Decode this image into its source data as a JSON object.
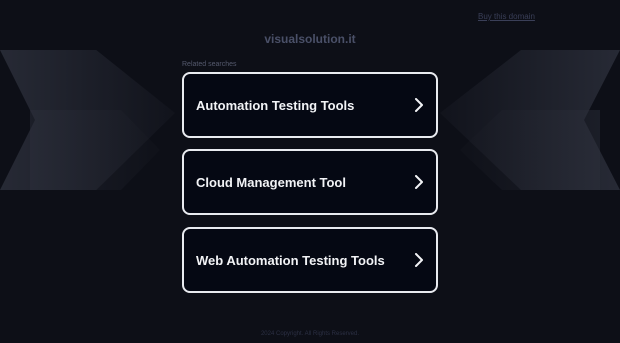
{
  "header": {
    "top_link": "Buy this domain",
    "site_title": "visualsolution.it"
  },
  "related": {
    "label": "Related searches",
    "items": [
      {
        "label": "Automation Testing Tools"
      },
      {
        "label": "Cloud Management Tool"
      },
      {
        "label": "Web Automation Testing Tools"
      }
    ]
  },
  "footer": {
    "text": "2024 Copyright. All Rights Reserved."
  },
  "colors": {
    "background": "#0d0f17",
    "card_background": "#050813",
    "card_border": "#e9ebf0",
    "card_text": "#f2f3f6"
  },
  "icons": {
    "card_arrow": "chevron-right-icon"
  }
}
